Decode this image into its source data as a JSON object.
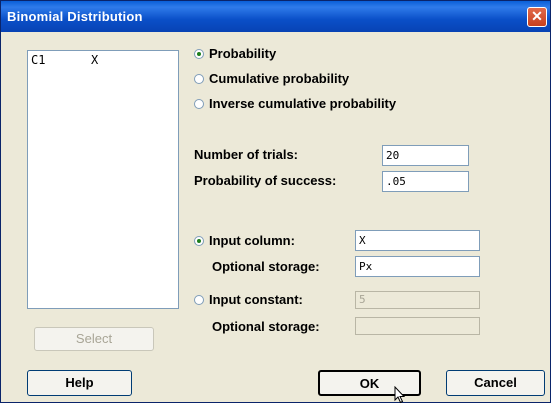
{
  "window": {
    "title": "Binomial Distribution",
    "close_glyph": "✕"
  },
  "columns_list": {
    "items": [
      {
        "col": "C1",
        "name": "X"
      }
    ]
  },
  "select_button": "Select",
  "mode_options": [
    {
      "label": "Probability",
      "checked": true
    },
    {
      "label": "Cumulative probability",
      "checked": false
    },
    {
      "label": "Inverse cumulative probability",
      "checked": false
    }
  ],
  "params": {
    "trials_label": "Number of trials:",
    "trials_value": "20",
    "prob_label": "Probability of success:",
    "prob_value": ".05"
  },
  "input_column": {
    "label": "Input column:",
    "checked": true,
    "value": "X",
    "storage_label": "Optional storage:",
    "storage_value": "Px"
  },
  "input_constant": {
    "label": "Input constant:",
    "checked": false,
    "value": "5",
    "storage_label": "Optional storage:",
    "storage_value": ""
  },
  "buttons": {
    "help": "Help",
    "ok": "OK",
    "cancel": "Cancel"
  },
  "colors": {
    "title_bar": "#0A4FC8",
    "dialog_bg": "#ECE9D8",
    "radio_dot": "#1E7F1E"
  }
}
